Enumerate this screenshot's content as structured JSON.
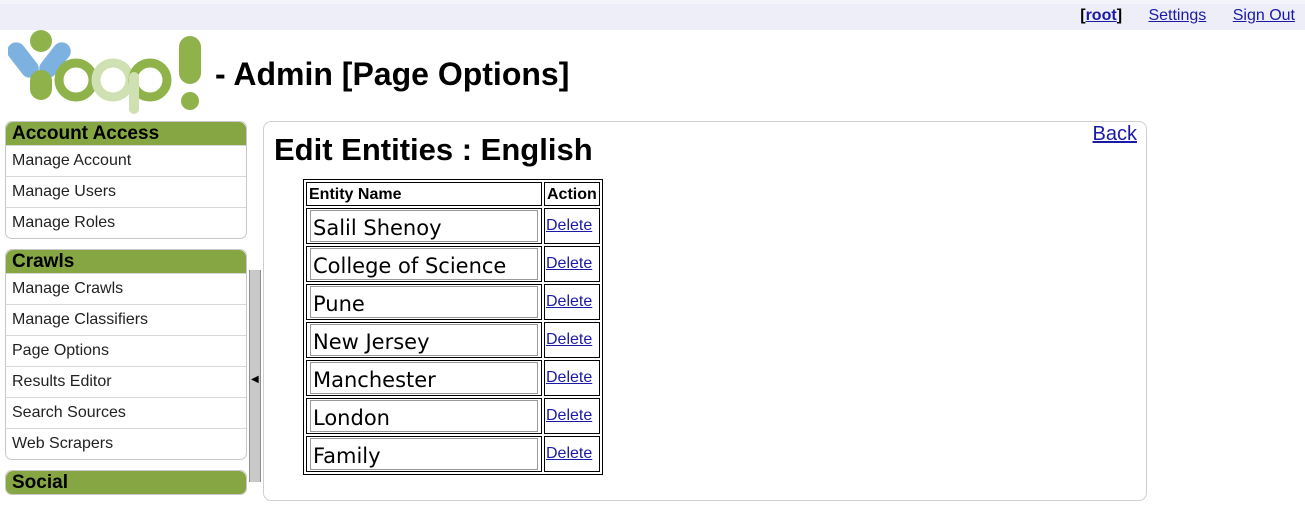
{
  "topbar": {
    "user_open": "[",
    "user": "root",
    "user_close": "]",
    "settings": "Settings",
    "sign_out": "Sign Out"
  },
  "header": {
    "title": "- Admin [Page Options]"
  },
  "sidebar": {
    "sections": [
      {
        "title": "Account Access",
        "items": [
          "Manage Account",
          "Manage Users",
          "Manage Roles"
        ]
      },
      {
        "title": "Crawls",
        "items": [
          "Manage Crawls",
          "Manage Classifiers",
          "Page Options",
          "Results Editor",
          "Search Sources",
          "Web Scrapers"
        ]
      },
      {
        "title": "Social",
        "items": []
      }
    ]
  },
  "main": {
    "title": "Edit Entities : English",
    "back": "Back",
    "table": {
      "headers": [
        "Entity Name",
        "Action"
      ],
      "rows": [
        {
          "name": "Salil Shenoy",
          "action": "Delete"
        },
        {
          "name": "College of Science",
          "action": "Delete"
        },
        {
          "name": "Pune",
          "action": "Delete"
        },
        {
          "name": "New Jersey",
          "action": "Delete"
        },
        {
          "name": "Manchester",
          "action": "Delete"
        },
        {
          "name": "London",
          "action": "Delete"
        },
        {
          "name": "Family",
          "action": "Delete"
        }
      ]
    }
  },
  "colors": {
    "topbar_bg": "#eeeef9",
    "panel_header": "#85a642",
    "link": "#1a1aa6",
    "logo_green": "#8fb34a",
    "logo_blue": "#6fa8dc"
  },
  "icons": {
    "splitter": "collapse-left-arrow-icon",
    "logo": "yoop-logo"
  }
}
